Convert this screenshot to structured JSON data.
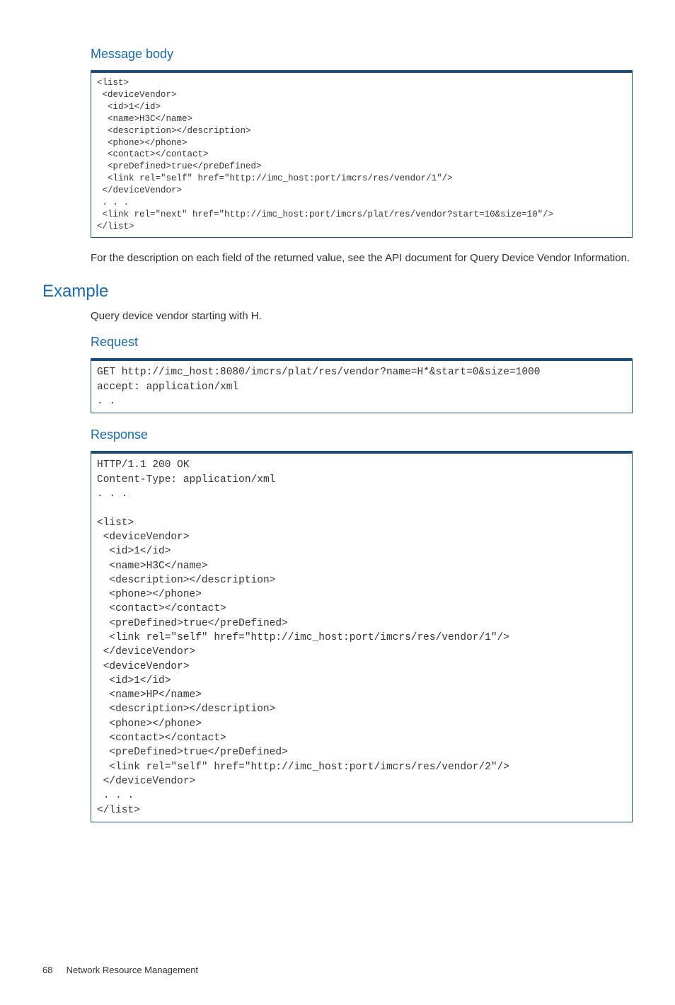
{
  "headings": {
    "message_body": "Message body",
    "example": "Example",
    "request": "Request",
    "response": "Response"
  },
  "paragraphs": {
    "desc_ref": "For the description on each field of the returned value, see the API document for Query Device Vendor Information.",
    "example_intro": "Query device vendor starting with H."
  },
  "code": {
    "message_body": "<list>\n <deviceVendor>\n  <id>1</id>\n  <name>H3C</name>\n  <description></description>\n  <phone></phone>\n  <contact></contact>\n  <preDefined>true</preDefined>\n  <link rel=\"self\" href=\"http://imc_host:port/imcrs/res/vendor/1\"/>\n </deviceVendor>\n . . .\n <link rel=\"next\" href=\"http://imc_host:port/imcrs/plat/res/vendor?start=10&size=10\"/>\n</list>",
    "request": "GET http://imc_host:8080/imcrs/plat/res/vendor?name=H*&start=0&size=1000\naccept: application/xml\n. .",
    "response": "HTTP/1.1 200 OK\nContent-Type: application/xml\n. . .\n\n<list>\n <deviceVendor>\n  <id>1</id>\n  <name>H3C</name>\n  <description></description>\n  <phone></phone>\n  <contact></contact>\n  <preDefined>true</preDefined>\n  <link rel=\"self\" href=\"http://imc_host:port/imcrs/res/vendor/1\"/>\n </deviceVendor>\n <deviceVendor>\n  <id>1</id>\n  <name>HP</name>\n  <description></description>\n  <phone></phone>\n  <contact></contact>\n  <preDefined>true</preDefined>\n  <link rel=\"self\" href=\"http://imc_host:port/imcrs/res/vendor/2\"/>\n </deviceVendor>\n . . .\n</list>"
  },
  "footer": {
    "page_number": "68",
    "chapter": "Network Resource Management"
  }
}
